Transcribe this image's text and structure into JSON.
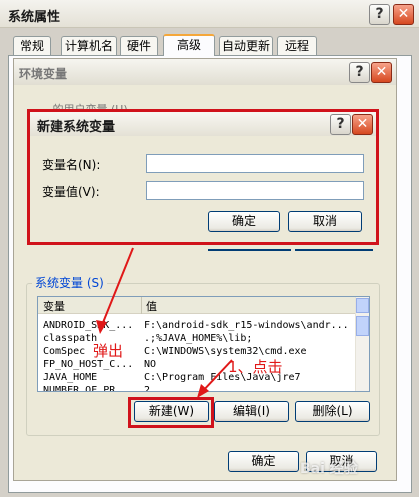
{
  "outer": {
    "title": "系统属性",
    "help": "?",
    "close": "✕"
  },
  "tabs": [
    "常规",
    "计算机名",
    "硬件",
    "高级",
    "自动更新",
    "远程"
  ],
  "env": {
    "title": "环境变量",
    "help": "?",
    "close": "✕",
    "user_group_partial": "… 的用户变量 (U)",
    "sys_group": "系统变量 (S)",
    "col_var": "变量",
    "col_val": "值",
    "rows": [
      {
        "name": "ANDROID_SDK_...",
        "value": "F:\\android-sdk_r15-windows\\andr..."
      },
      {
        "name": "classpath",
        "value": ".;%JAVA_HOME%\\lib;"
      },
      {
        "name": "ComSpec",
        "value": "C:\\WINDOWS\\system32\\cmd.exe"
      },
      {
        "name": "FP_NO_HOST_C...",
        "value": "NO"
      },
      {
        "name": "JAVA_HOME",
        "value": "C:\\Program Files\\Java\\jre7"
      },
      {
        "name": "NUMBER_OF_PR...",
        "value": "2"
      }
    ],
    "new_btn": "新建(W)",
    "edit_btn": "编辑(I)",
    "delete_btn": "删除(L)",
    "ok": "确定",
    "cancel": "取消"
  },
  "newvar": {
    "title": "新建系统变量",
    "help": "?",
    "close": "✕",
    "name_label": "变量名(N):",
    "value_label": "变量值(V):",
    "name_value": "",
    "value_value": "",
    "ok": "确定",
    "cancel": "取消"
  },
  "annotations": {
    "popup": "弹出",
    "click": "1、点击"
  },
  "watermark": "Bai 经验",
  "colors": {
    "accent": "#d0121b",
    "xp_blue": "#003c74"
  }
}
